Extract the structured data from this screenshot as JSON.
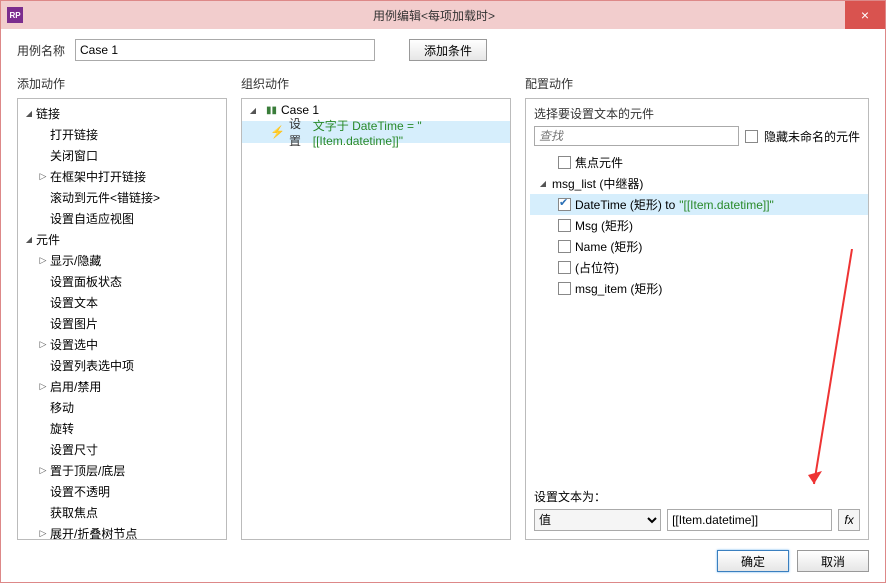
{
  "window": {
    "title": "用例编辑<每项加载时>"
  },
  "top": {
    "case_name_label": "用例名称",
    "case_name_value": "Case 1",
    "add_condition": "添加条件"
  },
  "sections": {
    "add_action": "添加动作",
    "organize_action": "组织动作",
    "configure_action": "配置动作"
  },
  "left_tree": [
    {
      "level": 0,
      "arrow": "open",
      "label": "链接"
    },
    {
      "level": 1,
      "arrow": "none",
      "label": "打开链接"
    },
    {
      "level": 1,
      "arrow": "none",
      "label": "关闭窗口"
    },
    {
      "level": 1,
      "arrow": "closed",
      "label": "在框架中打开链接"
    },
    {
      "level": 1,
      "arrow": "none",
      "label": "滚动到元件<错链接>"
    },
    {
      "level": 1,
      "arrow": "none",
      "label": "设置自适应视图"
    },
    {
      "level": 0,
      "arrow": "open",
      "label": "元件"
    },
    {
      "level": 1,
      "arrow": "closed",
      "label": "显示/隐藏"
    },
    {
      "level": 1,
      "arrow": "none",
      "label": "设置面板状态"
    },
    {
      "level": 1,
      "arrow": "none",
      "label": "设置文本"
    },
    {
      "level": 1,
      "arrow": "none",
      "label": "设置图片"
    },
    {
      "level": 1,
      "arrow": "closed",
      "label": "设置选中"
    },
    {
      "level": 1,
      "arrow": "none",
      "label": "设置列表选中项"
    },
    {
      "level": 1,
      "arrow": "closed",
      "label": "启用/禁用"
    },
    {
      "level": 1,
      "arrow": "none",
      "label": "移动"
    },
    {
      "level": 1,
      "arrow": "none",
      "label": "旋转"
    },
    {
      "level": 1,
      "arrow": "none",
      "label": "设置尺寸"
    },
    {
      "level": 1,
      "arrow": "closed",
      "label": "置于顶层/底层"
    },
    {
      "level": 1,
      "arrow": "none",
      "label": "设置不透明"
    },
    {
      "level": 1,
      "arrow": "none",
      "label": "获取焦点"
    },
    {
      "level": 1,
      "arrow": "closed",
      "label": "展开/折叠树节点"
    }
  ],
  "mid": {
    "case_label": "Case 1",
    "action_prefix": "设置 ",
    "action_green": "文字于 DateTime = \"[[Item.datetime]]\""
  },
  "right": {
    "header": "选择要设置文本的元件",
    "search_placeholder": "查找",
    "hide_unnamed": "隐藏未命名的元件",
    "items": [
      {
        "level": 1,
        "checked": false,
        "arrow": "none",
        "label": "焦点元件",
        "extra": ""
      },
      {
        "level": 0,
        "checked": null,
        "arrow": "open",
        "label": "msg_list (中继器)",
        "extra": ""
      },
      {
        "level": 1,
        "checked": true,
        "arrow": "none",
        "label": "DateTime (矩形) to ",
        "extra": "\"[[Item.datetime]]\"",
        "selected": true
      },
      {
        "level": 1,
        "checked": false,
        "arrow": "none",
        "label": "Msg (矩形)",
        "extra": ""
      },
      {
        "level": 1,
        "checked": false,
        "arrow": "none",
        "label": "Name (矩形)",
        "extra": ""
      },
      {
        "level": 1,
        "checked": false,
        "arrow": "none",
        "label": "(占位符)",
        "extra": ""
      },
      {
        "level": 1,
        "checked": false,
        "arrow": "none",
        "label": "msg_item (矩形)",
        "extra": ""
      }
    ],
    "set_text_label": "设置文本为：",
    "value_select": "值",
    "value_input": "[[Item.datetime]]",
    "fx": "fx"
  },
  "buttons": {
    "ok": "确定",
    "cancel": "取消"
  }
}
